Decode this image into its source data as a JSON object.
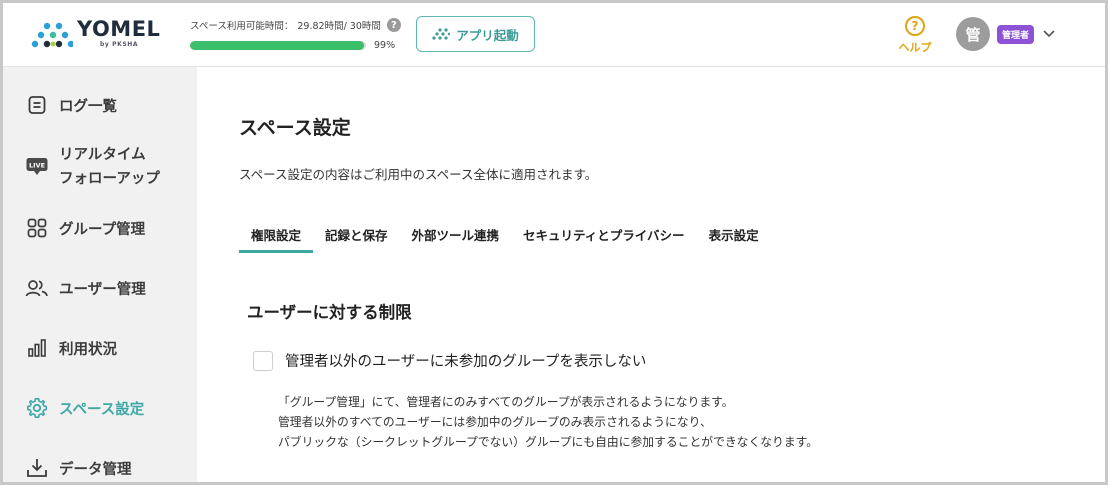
{
  "header": {
    "logo": {
      "name": "YOMEL",
      "sub": "by PKSHA"
    },
    "usage": {
      "label": "スペース利用可能時間：",
      "value": "29.82時間/ 30時間",
      "help_icon": "?",
      "progress_fraction": 0.99,
      "percent_label": "99%"
    },
    "launch_button": {
      "label": "アプリ起動",
      "icon": "yomel-mark-icon"
    },
    "help": {
      "label": "ヘルプ",
      "icon": "?"
    },
    "user": {
      "avatar": "管",
      "role": "管理者"
    }
  },
  "sidebar": {
    "items": [
      {
        "label": "ログ一覧",
        "icon": "log-list-icon",
        "active": false
      },
      {
        "label": "リアルタイム",
        "label2": "フォローアップ",
        "icon": "live-icon",
        "icon_text": "LIVE",
        "active": false
      },
      {
        "label": "グループ管理",
        "icon": "grid-icon",
        "active": false
      },
      {
        "label": "ユーザー管理",
        "icon": "users-icon",
        "active": false
      },
      {
        "label": "利用状況",
        "icon": "bar-chart-icon",
        "active": false
      },
      {
        "label": "スペース設定",
        "icon": "gear-icon",
        "active": true
      },
      {
        "label": "データ管理",
        "icon": "download-icon",
        "active": false
      }
    ]
  },
  "main": {
    "title": "スペース設定",
    "description": "スペース設定の内容はご利用中のスペース全体に適用されます。",
    "tabs": [
      {
        "label": "権限設定",
        "active": true
      },
      {
        "label": "記録と保存",
        "active": false
      },
      {
        "label": "外部ツール連携",
        "active": false
      },
      {
        "label": "セキュリティとプライバシー",
        "active": false
      },
      {
        "label": "表示設定",
        "active": false
      }
    ],
    "section_title": "ユーザーに対する制限",
    "option": {
      "label": "管理者以外のユーザーに未参加のグループを表示しない",
      "checked": false,
      "description": [
        "「グループ管理」にて、管理者にのみすべてのグループが表示されるようになります。",
        "管理者以外のすべてのユーザーには参加中のグループのみ表示されるようになり、",
        "パブリックな（シークレットグループでない）グループにも自由に参加することができなくなります。"
      ]
    }
  },
  "colors": {
    "accent": "#3fa8a5",
    "help": "#e0a410",
    "role_badge": "#8e52d6",
    "progress": "#3bbf6a"
  }
}
